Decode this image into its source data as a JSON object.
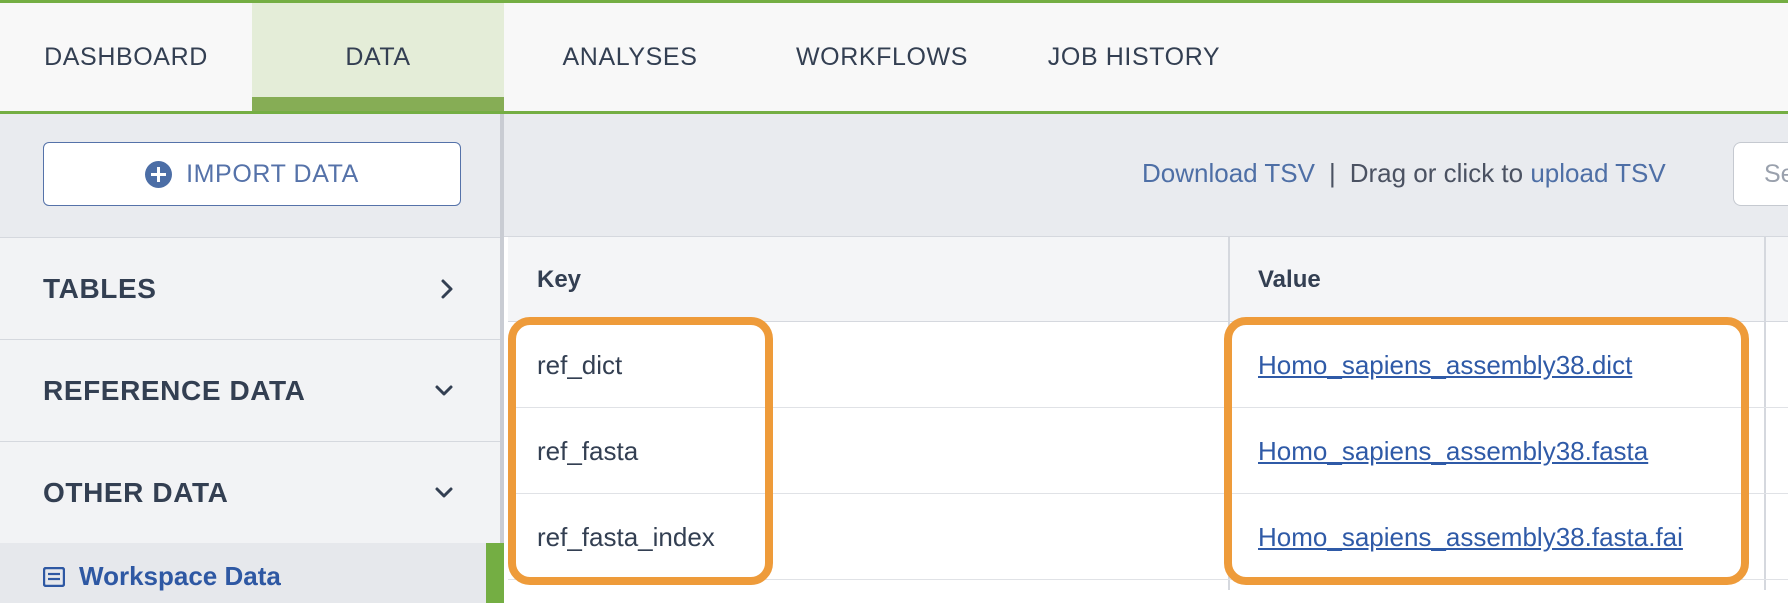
{
  "tabs": [
    {
      "label": "DASHBOARD"
    },
    {
      "label": "DATA"
    },
    {
      "label": "ANALYSES"
    },
    {
      "label": "WORKFLOWS"
    },
    {
      "label": "JOB HISTORY"
    }
  ],
  "active_tab": "DATA",
  "sidebar": {
    "import_label": "IMPORT DATA",
    "sections": [
      {
        "label": "TABLES",
        "icon": "chevron-right-icon"
      },
      {
        "label": "REFERENCE DATA",
        "icon": "chevron-down-icon"
      },
      {
        "label": "OTHER DATA",
        "icon": "chevron-down-icon"
      }
    ],
    "workspace_item": {
      "label": "Workspace Data",
      "icon": "list-icon"
    }
  },
  "toolbar": {
    "download_label": "Download TSV",
    "separator": "|",
    "drag_text": "Drag or click to",
    "upload_label": "upload TSV",
    "search_placeholder": "Search"
  },
  "table": {
    "headers": [
      "Key",
      "Value"
    ],
    "rows": [
      {
        "key": "ref_dict",
        "value": "Homo_sapiens_assembly38.dict"
      },
      {
        "key": "ref_fasta",
        "value": "Homo_sapiens_assembly38.fasta"
      },
      {
        "key": "ref_fasta_index",
        "value": "Homo_sapiens_assembly38.fasta.fai"
      }
    ]
  },
  "colors": {
    "brand_green": "#74ae43",
    "link_blue": "#2f5aa7",
    "highlight_orange": "#ee9b3a"
  }
}
